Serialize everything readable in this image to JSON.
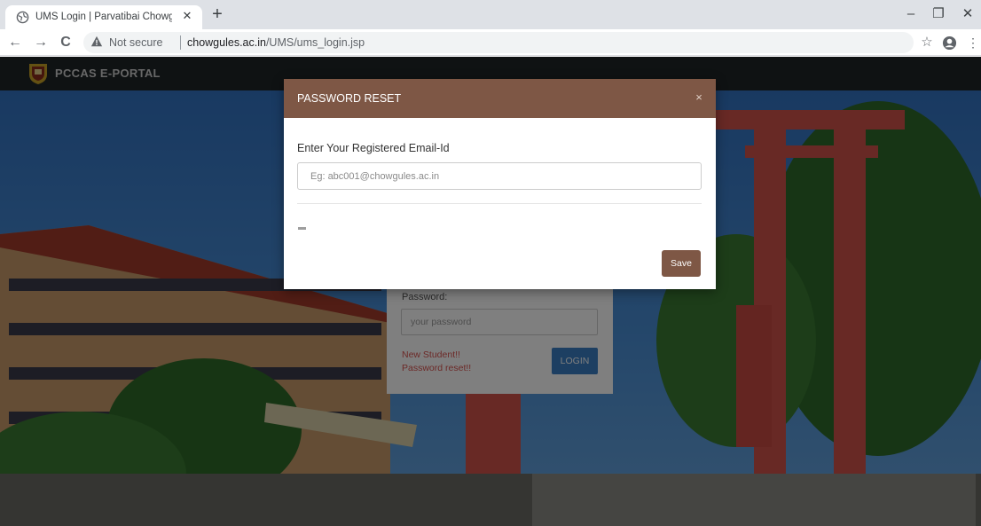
{
  "browser": {
    "tab_title": "UMS Login | Parvatibai Chowgule",
    "tab_close": "✕",
    "new_tab": "+",
    "back": "←",
    "forward": "→",
    "reload": "C",
    "security_label": "Not secure",
    "url_host": "chowgules.ac.in",
    "url_path": "/UMS/ums_login.jsp",
    "star": "☆",
    "menu": "⋮",
    "minimize": "–",
    "restore": "❐",
    "close": "✕",
    "icons": [
      "globe-icon",
      "warning-icon",
      "star-icon",
      "profile-icon"
    ]
  },
  "navbar": {
    "brand": "PCCAS E-PORTAL"
  },
  "login": {
    "password_label": "Password:",
    "password_placeholder": "your password",
    "new_student": "New Student!!",
    "password_reset": "Password reset!!",
    "login_button": "LOGIN"
  },
  "modal": {
    "title": "PASSWORD RESET",
    "close": "×",
    "email_label": "Enter Your Registered Email-Id",
    "email_placeholder": "Eg: abc001@chowgules.ac.in",
    "save_button": "Save"
  },
  "colors": {
    "modal_header": "#7e5745",
    "navbar": "#1f2426",
    "login_button": "#3b7fc4",
    "link": "#d9534f"
  }
}
